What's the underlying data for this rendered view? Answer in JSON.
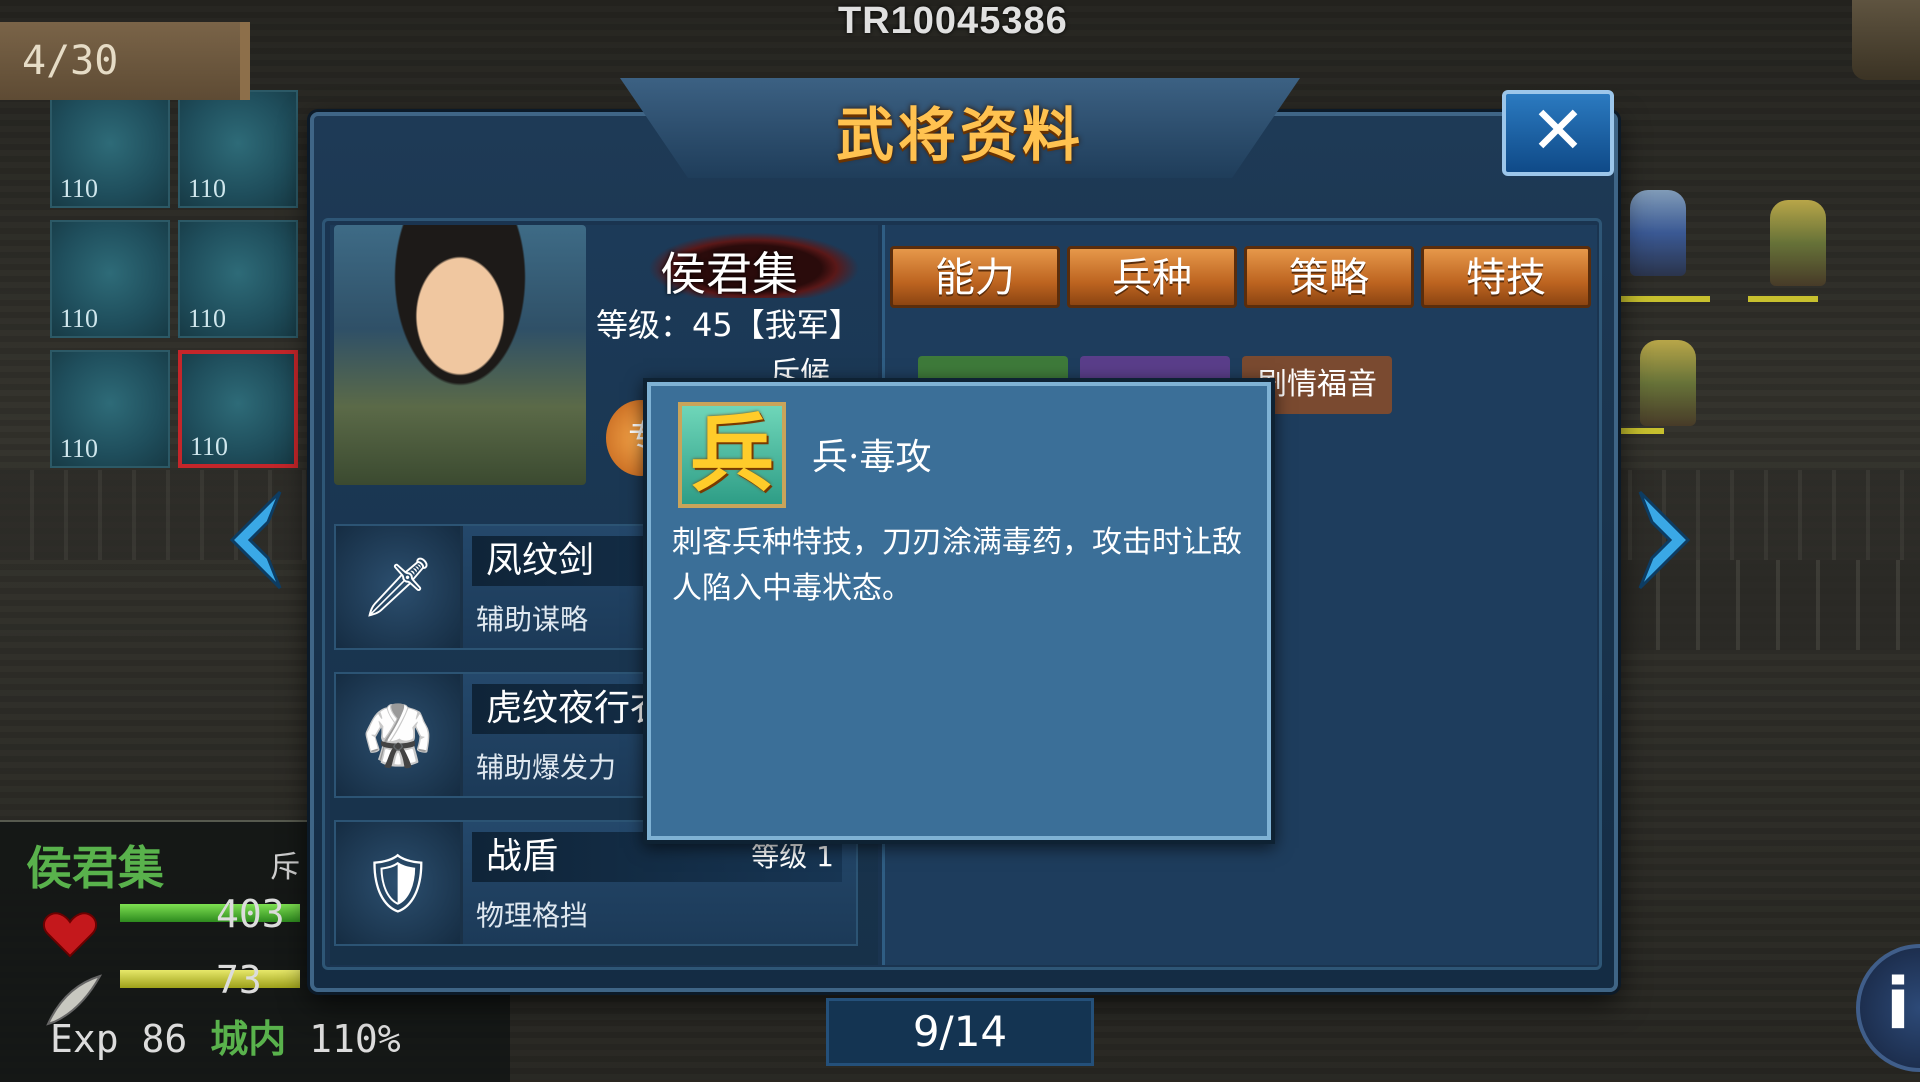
{
  "hud": {
    "turn": "4/30",
    "player_id": "TR10045386",
    "tile_values": [
      "110",
      "110",
      "110",
      "110",
      "110",
      "110"
    ]
  },
  "status": {
    "name": "侯君集",
    "class_short": "斥",
    "hp": "403",
    "mp": "73",
    "exp_label": "Exp",
    "exp_value": "86",
    "location": "城内",
    "terrain_bonus": "110%"
  },
  "dialog": {
    "title": "武将资料",
    "close_label": "✕",
    "general": {
      "name": "侯君集",
      "level_line": "等级：45【我军】",
      "class": "斥候",
      "medal": "专"
    },
    "equipment": [
      {
        "name": "凤纹剑",
        "level": "",
        "effect": "辅助谋略",
        "icon": "sword-icon",
        "glyph": "🗡"
      },
      {
        "name": "虎纹夜行衣",
        "level": "",
        "effect": "辅助爆发力",
        "icon": "armor-icon",
        "glyph": "🥋"
      },
      {
        "name": "战盾",
        "level": "等级 1",
        "effect": "物理格挡",
        "icon": "shield-icon",
        "glyph": "🛡"
      }
    ],
    "tabs": [
      "能力",
      "兵种",
      "策略",
      "特技"
    ],
    "skill_chips": [
      {
        "label": "",
        "color": "#3e7a3a"
      },
      {
        "label": "",
        "color": "#5a3e8a"
      },
      {
        "label": "剧情福音",
        "color": "#7a4a30"
      }
    ],
    "popup": {
      "icon_char": "兵",
      "title": "兵·毒攻",
      "description": "刺客兵种特技，刀刃涂满毒药，攻击时让敌人陷入中毒状态。"
    },
    "page": "9/14"
  },
  "colors": {
    "accent_gold": "#ffc250",
    "tab_orange": "#bd6420",
    "hp_green": "#59b24c",
    "panel_blue": "#1e3d5d"
  }
}
